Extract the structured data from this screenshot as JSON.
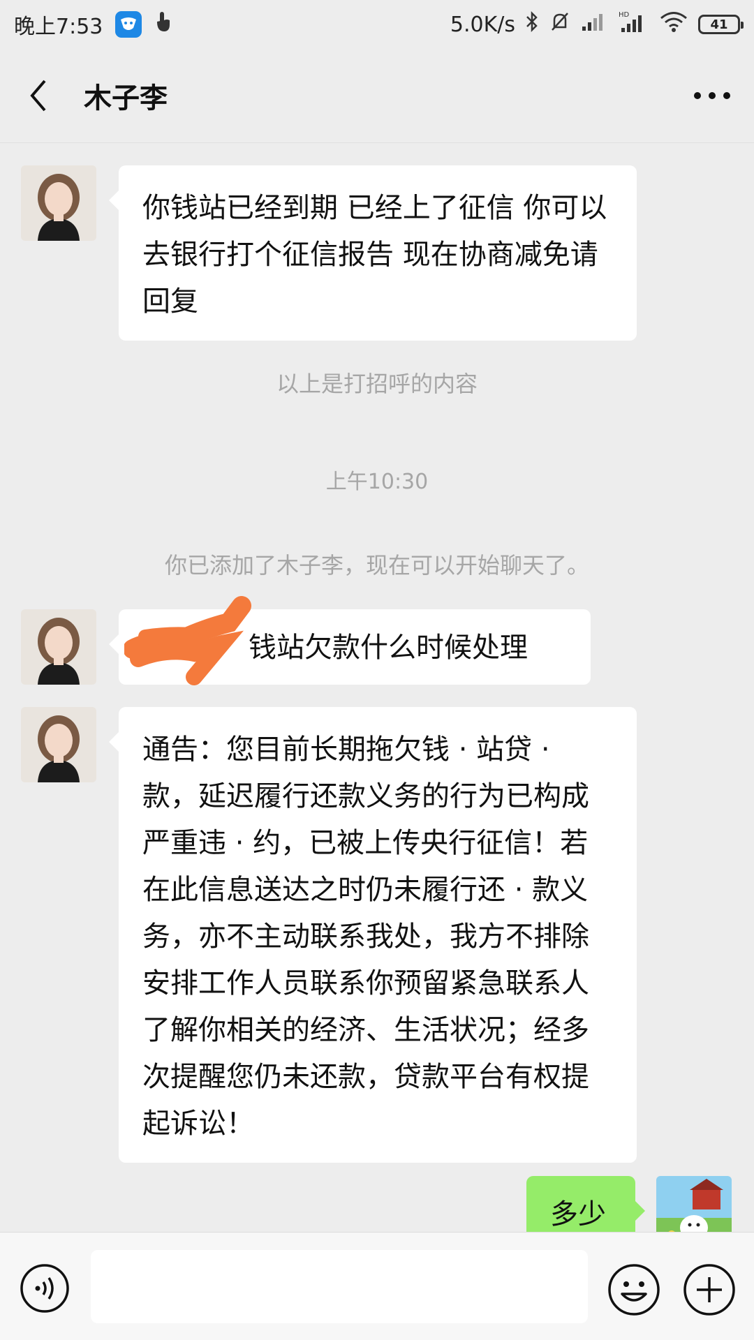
{
  "status_bar": {
    "time": "晚上7:53",
    "network_speed": "5.0K/s",
    "battery": "41"
  },
  "header": {
    "title": "木子李"
  },
  "messages": [
    {
      "type": "received",
      "text": "你钱站已经到期 已经上了征信  你可以去银行打个征信报告  现在协商减免请回复"
    },
    {
      "type": "system",
      "text": "以上是打招呼的内容"
    },
    {
      "type": "time",
      "text": "上午10:30"
    },
    {
      "type": "system",
      "text": "你已添加了木子李，现在可以开始聊天了。"
    },
    {
      "type": "received",
      "text": "钱站欠款什么时候处理",
      "redacted_prefix": true
    },
    {
      "type": "received",
      "text": "通告：您目前长期拖欠钱 · 站贷 · 款，延迟履行还款义务的行为已构成严重违 · 约，已被上传央行征信！若在此信息送达之时仍未履行还 · 款义务，亦不主动联系我处，我方不排除安排工作人员联系你预留紧急联系人了解你相关的经济、生活状况；经多次提醒您仍未还款，贷款平台有权提起诉讼！"
    },
    {
      "type": "sent",
      "text": "多少"
    }
  ],
  "icons": {
    "back": "chevron-left-icon",
    "more": "more-dots-icon",
    "voice": "voice-icon",
    "emoji": "emoji-icon",
    "plus": "plus-icon"
  },
  "colors": {
    "background": "#ededed",
    "received_bubble": "#ffffff",
    "sent_bubble": "#95ec69",
    "redaction": "#f47a3c"
  }
}
